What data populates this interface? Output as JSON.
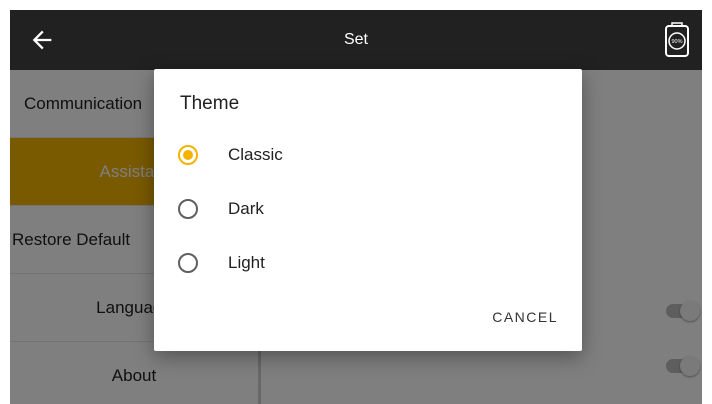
{
  "header": {
    "title": "Set",
    "back_icon": "arrow-left-icon",
    "battery_icon": "battery-icon",
    "battery_level": "90%"
  },
  "sidebar": {
    "items": [
      {
        "label": "Communication"
      },
      {
        "label": "Assistant"
      },
      {
        "label": "Restore Default"
      },
      {
        "label": "Language"
      },
      {
        "label": "About"
      }
    ]
  },
  "dialog": {
    "title": "Theme",
    "options": [
      {
        "label": "Classic",
        "selected": true
      },
      {
        "label": "Dark",
        "selected": false
      },
      {
        "label": "Light",
        "selected": false
      }
    ],
    "cancel_label": "CANCEL"
  },
  "colors": {
    "accent": "#f2b400",
    "appbar": "#212121"
  }
}
